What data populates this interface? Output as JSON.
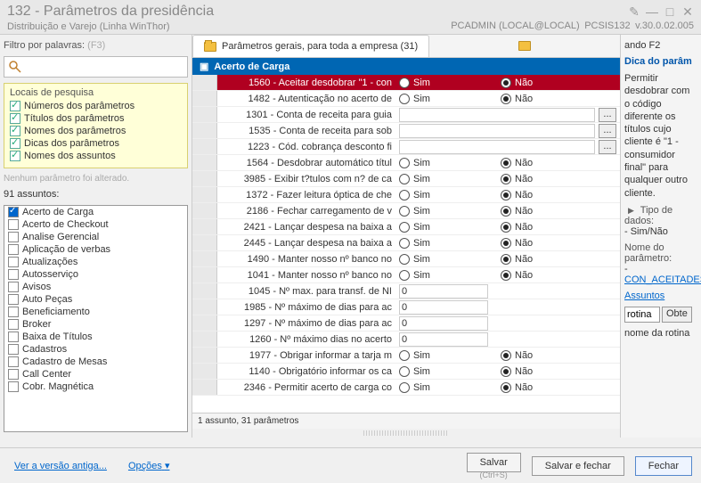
{
  "window": {
    "title": "132 - Parâmetros da presidência",
    "subtitle": "Distribuição e Varejo (Linha WinThor)",
    "user": "PCADMIN (LOCAL@LOCAL)",
    "module": "PCSIS132",
    "version": "v.30.0.02.005"
  },
  "filter": {
    "label": "Filtro por palavras:",
    "hint": "(F3)"
  },
  "search_locations": {
    "title": "Locais de pesquisa",
    "items": [
      {
        "label": "Números dos parâmetros",
        "checked": true
      },
      {
        "label": "Títulos dos parâmetros",
        "checked": true
      },
      {
        "label": "Nomes dos parâmetros",
        "checked": true
      },
      {
        "label": "Dicas dos parâmetros",
        "checked": true
      },
      {
        "label": "Nomes dos assuntos",
        "checked": true
      }
    ]
  },
  "status_left": "Nenhum parâmetro foi alterado.",
  "subjects": {
    "label": "91 assuntos:",
    "items": [
      {
        "label": "Acerto de Carga",
        "checked": true
      },
      {
        "label": "Acerto de Checkout",
        "checked": false
      },
      {
        "label": "Analise Gerencial",
        "checked": false
      },
      {
        "label": "Aplicação de verbas",
        "checked": false
      },
      {
        "label": "Atualizações",
        "checked": false
      },
      {
        "label": "Autosserviço",
        "checked": false
      },
      {
        "label": "Avisos",
        "checked": false
      },
      {
        "label": "Auto Peças",
        "checked": false
      },
      {
        "label": "Beneficiamento",
        "checked": false
      },
      {
        "label": "Broker",
        "checked": false
      },
      {
        "label": "Baixa de Títulos",
        "checked": false
      },
      {
        "label": "Cadastros",
        "checked": false
      },
      {
        "label": "Cadastro de Mesas",
        "checked": false
      },
      {
        "label": "Call Center",
        "checked": false
      },
      {
        "label": "Cobr. Magnética",
        "checked": false
      }
    ]
  },
  "tabs": {
    "main": "Parâmetros gerais, para toda a empresa  (31)"
  },
  "grid": {
    "group": "Acerto de Carga",
    "rows": [
      {
        "id": "1560",
        "label": "1560 - Aceitar desdobrar \"1 - con",
        "type": "radio",
        "value": "Não",
        "selected": true
      },
      {
        "id": "1482",
        "label": "1482 - Autenticação no acerto de",
        "type": "radio",
        "value": "Não"
      },
      {
        "id": "1301",
        "label": "1301 - Conta de receita para guia",
        "type": "lookup"
      },
      {
        "id": "1535",
        "label": "1535 - Conta de receita para sob",
        "type": "lookup"
      },
      {
        "id": "1223",
        "label": "1223 - Cód. cobrança desconto fi",
        "type": "lookup"
      },
      {
        "id": "1564",
        "label": "1564 - Desdobrar automático títul",
        "type": "radio",
        "value": "Não"
      },
      {
        "id": "3985",
        "label": "3985 - Exibir t?tulos com n? de ca",
        "type": "radio",
        "value": "Não"
      },
      {
        "id": "1372",
        "label": "1372 - Fazer leitura óptica de che",
        "type": "radio",
        "value": "Não"
      },
      {
        "id": "2186",
        "label": "2186 - Fechar carregamento de v",
        "type": "radio",
        "value": "Não"
      },
      {
        "id": "2421",
        "label": "2421 - Lançar despesa na baixa a",
        "type": "radio",
        "value": "Não"
      },
      {
        "id": "2445",
        "label": "2445 - Lançar despesa na baixa a",
        "type": "radio",
        "value": "Não"
      },
      {
        "id": "1490",
        "label": "1490 - Manter nosso nº banco no",
        "type": "radio",
        "value": "Não"
      },
      {
        "id": "1041",
        "label": "1041 - Manter nosso nº banco no",
        "type": "radio",
        "value": "Não"
      },
      {
        "id": "1045",
        "label": "1045 - Nº max. para transf. de NI",
        "type": "number",
        "value": "0"
      },
      {
        "id": "1985",
        "label": "1985 - Nº máximo de dias para ac",
        "type": "number",
        "value": "0"
      },
      {
        "id": "1297",
        "label": "1297 - Nº máximo de dias para ac",
        "type": "number",
        "value": "0"
      },
      {
        "id": "1260",
        "label": "1260 - Nº máximo dias no acerto",
        "type": "number",
        "value": "0"
      },
      {
        "id": "1977",
        "label": "1977 - Obrigar informar a tarja m",
        "type": "radio",
        "value": "Não"
      },
      {
        "id": "1140",
        "label": "1140 - Obrigatório informar os ca",
        "type": "radio",
        "value": "Não"
      },
      {
        "id": "2346",
        "label": "2346 - Permitir acerto de carga co",
        "type": "radio",
        "value": "Não"
      }
    ],
    "status": "1 assunto, 31 parâmetros",
    "yes": "Sim",
    "no": "Não"
  },
  "right": {
    "pressing": "ando F2",
    "hint_title": "Dica do parâm",
    "hint_body": "Permitir desdobrar com o código diferente os títulos cujo cliente é \"1 - consumidor final\" para qualquer outro cliente.",
    "type_label": "Tipo de dados:",
    "type_value": "- Sim/Não",
    "param_label": "Nome do parâmetro:",
    "param_value": "CON_ACEITADES",
    "subjects_label": "Assuntos",
    "routine_input": "rotina",
    "get_btn": "Obte",
    "routine_name": "nome da rotina"
  },
  "footer": {
    "old_version": "Ver a versão antiga...",
    "options": "Opções",
    "save": "Salvar",
    "save_hint": "(Ctrl+S)",
    "save_close": "Salvar e fechar",
    "close": "Fechar"
  }
}
